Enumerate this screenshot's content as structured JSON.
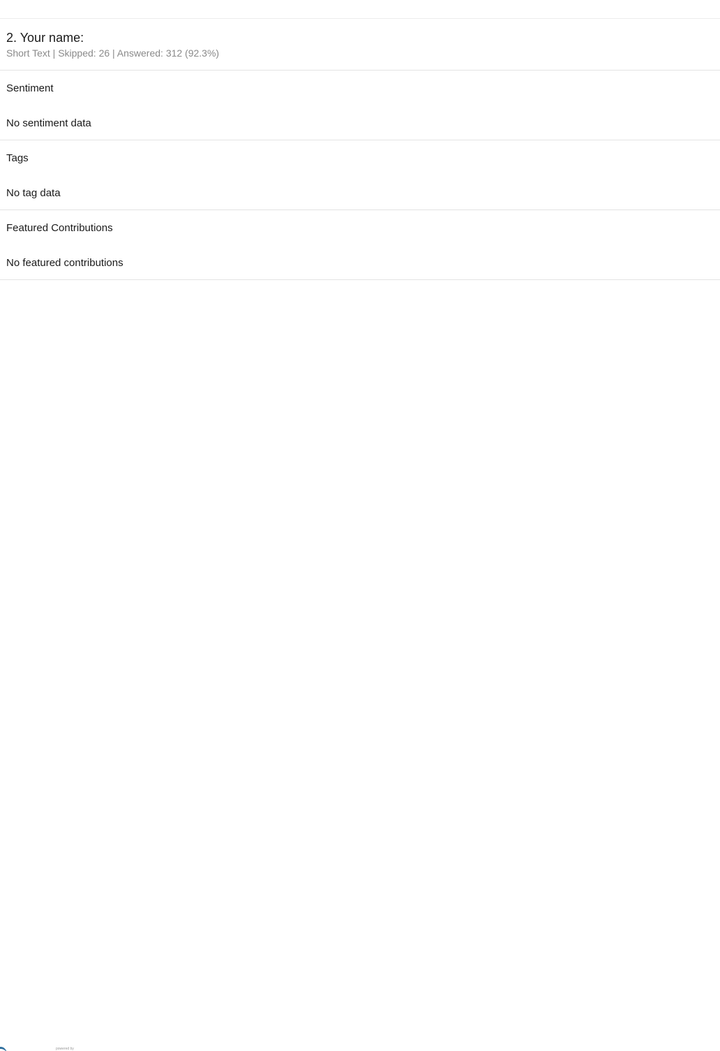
{
  "question": {
    "title": "2. Your name:",
    "meta": "Short Text | Skipped: 26 | Answered: 312 (92.3%)"
  },
  "sections": {
    "sentiment": {
      "heading": "Sentiment",
      "empty_text": "No sentiment data"
    },
    "tags": {
      "heading": "Tags",
      "empty_text": "No tag data"
    },
    "featured": {
      "heading": "Featured Contributions",
      "empty_text": "No featured contributions"
    }
  },
  "footer": {
    "note": "powered by"
  },
  "colors": {
    "meta_text": "#8a8a8a",
    "divider": "#e3e3e3",
    "logo_accent": "#2e6f9e"
  }
}
